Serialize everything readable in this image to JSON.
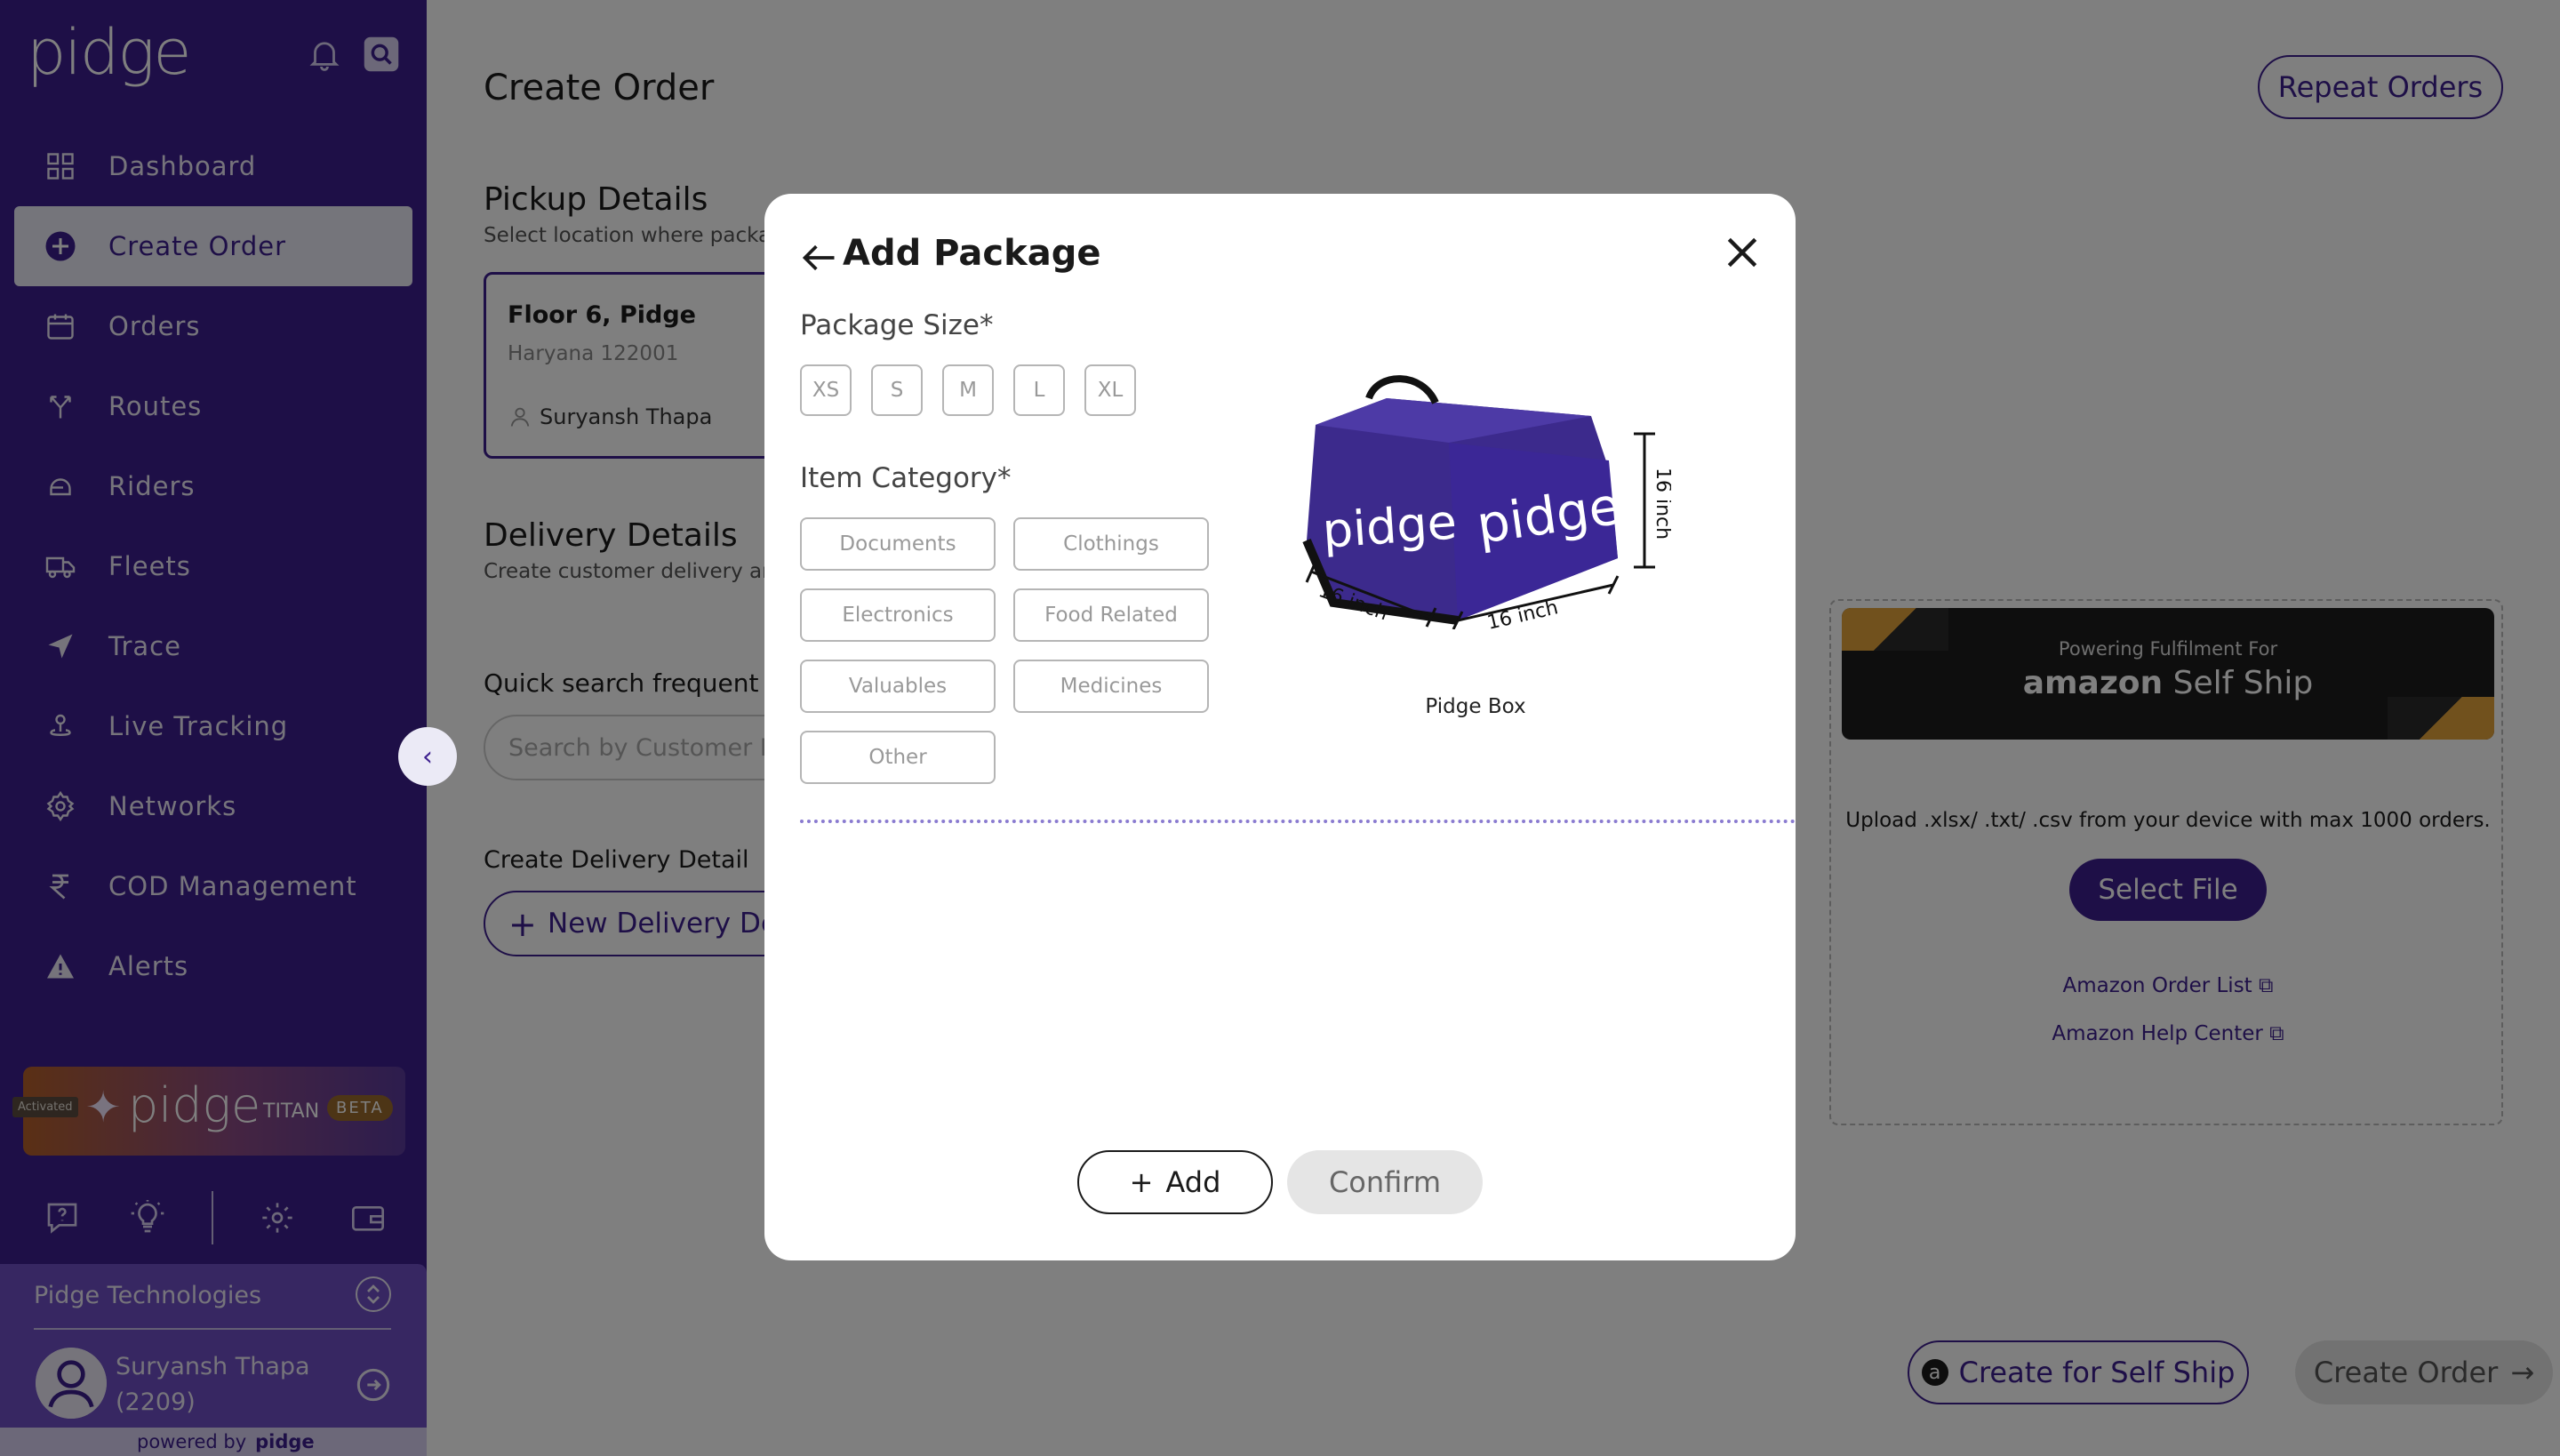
{
  "sidebar": {
    "logo": "pidge",
    "nav": [
      {
        "label": "Dashboard",
        "icon": "dashboard-icon"
      },
      {
        "label": "Create Order",
        "icon": "plus-circle-icon",
        "active": true
      },
      {
        "label": "Orders",
        "icon": "orders-icon"
      },
      {
        "label": "Routes",
        "icon": "routes-icon"
      },
      {
        "label": "Riders",
        "icon": "riders-icon"
      },
      {
        "label": "Fleets",
        "icon": "truck-icon"
      },
      {
        "label": "Trace",
        "icon": "navigation-icon"
      },
      {
        "label": "Live Tracking",
        "icon": "live-tracking-icon"
      },
      {
        "label": "Networks",
        "icon": "networks-icon"
      },
      {
        "label": "COD Management",
        "icon": "rupee-icon"
      },
      {
        "label": "Alerts",
        "icon": "alert-icon"
      }
    ],
    "titan": {
      "activated": "Activated",
      "brand": "pidge",
      "name": "TITAN",
      "badge": "BETA"
    },
    "org": {
      "name": "Pidge Technologies"
    },
    "user": {
      "name": "Suryansh Thapa",
      "id": "(2209)"
    },
    "powered_by": "powered by",
    "powered_brand": "pidge"
  },
  "main": {
    "title": "Create Order",
    "repeat_orders": "Repeat Orders",
    "pickup": {
      "title": "Pickup Details",
      "subtitle": "Select location where package",
      "address_line1": "Floor 6, Pidge",
      "address_line2": "Haryana 122001",
      "contact": "Suryansh Thapa"
    },
    "delivery": {
      "title": "Delivery Details",
      "subtitle": "Create customer delivery and",
      "quick_search_label": "Quick search frequent cu",
      "search_placeholder": "Search by Customer M",
      "create_label": "Create Delivery Detail",
      "new_button": "New Delivery Det"
    },
    "upload": {
      "powering": "Powering Fulfilment For",
      "amazon": "amazon",
      "self_ship": "Self Ship",
      "text": "Upload .xlsx/ .txt/ .csv from your device with max 1000 orders.",
      "select_file": "Select File",
      "order_list": "Amazon Order List",
      "help_center": "Amazon Help Center"
    },
    "create_self_ship": "Create for Self Ship",
    "create_order": "Create Order"
  },
  "modal": {
    "title": "Add Package",
    "size_label": "Package Size*",
    "sizes": [
      "XS",
      "S",
      "M",
      "L",
      "XL"
    ],
    "category_label": "Item Category*",
    "categories": [
      "Documents",
      "Clothings",
      "Electronics",
      "Food Related",
      "Valuables",
      "Medicines",
      "Other"
    ],
    "bag_brand": "pidge",
    "dim_height": "16 inch",
    "dim_depth": "16 inch",
    "dim_width": "16 inch",
    "bag_caption": "Pidge Box",
    "add_button": "Add",
    "confirm_button": "Confirm"
  },
  "colors": {
    "brand": "#3d1f8f",
    "overlay": "rgba(0,0,0,0.5)",
    "amazon_accent": "#e3a23b"
  }
}
